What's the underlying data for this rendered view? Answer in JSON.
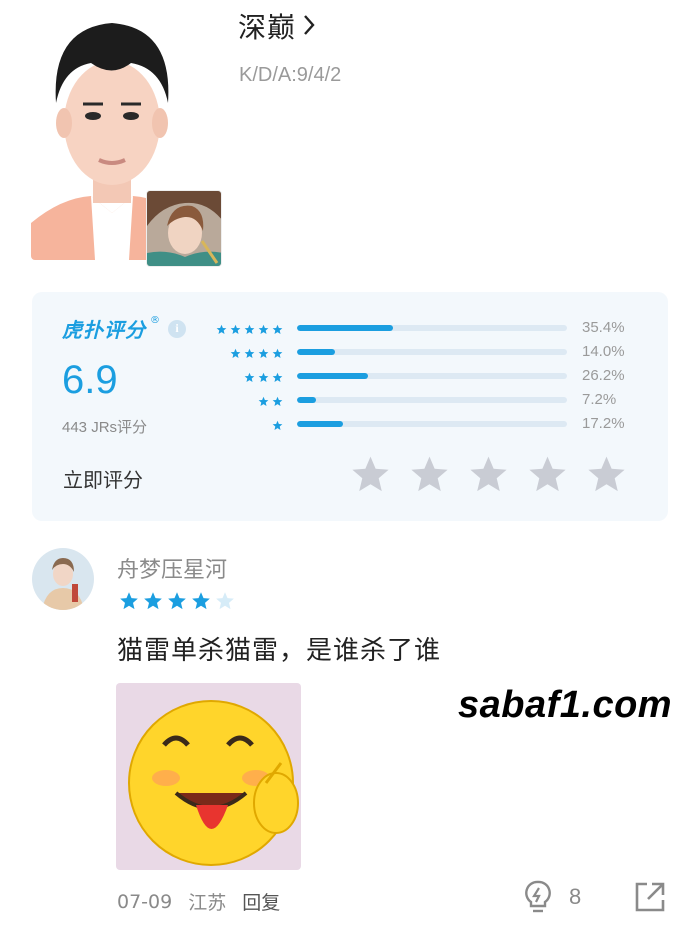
{
  "player": {
    "name": "深巅",
    "kda": "K/D/A:9/4/2"
  },
  "rating": {
    "brand": "虎扑评分",
    "brand_mark": "®",
    "info_glyph": "i",
    "score": "6.9",
    "votes": "443 JRs评分",
    "rate_now": "立即评分",
    "distribution": [
      {
        "stars": 5,
        "percent": 35.4,
        "label": "35.4%"
      },
      {
        "stars": 4,
        "percent": 14.0,
        "label": "14.0%"
      },
      {
        "stars": 3,
        "percent": 26.2,
        "label": "26.2%"
      },
      {
        "stars": 2,
        "percent": 7.2,
        "label": "7.2%"
      },
      {
        "stars": 1,
        "percent": 17.2,
        "label": "17.2%"
      }
    ],
    "accent_color": "#1b9ee0",
    "empty_star_color": "#c9ccd4"
  },
  "comment": {
    "username": "舟梦压星河",
    "rating_stars": 4,
    "rating_max": 5,
    "text": "猫雷单杀猫雷，是谁杀了谁",
    "date": "07-09",
    "location": "江苏",
    "reply_label": "回复",
    "like_count": "8"
  },
  "watermark": "sabaf1.com",
  "icons": {
    "chevron": "chevron-right-icon",
    "info": "info-icon",
    "like": "lightbulb-like-icon",
    "share": "share-external-icon"
  }
}
